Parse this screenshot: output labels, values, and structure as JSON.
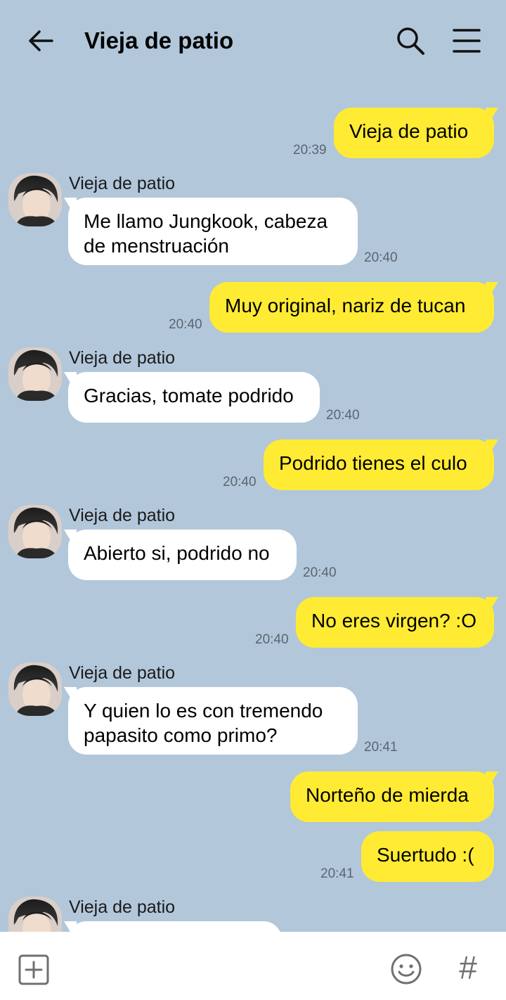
{
  "header": {
    "title": "Vieja de patio",
    "back_icon": "arrow-left-icon",
    "search_icon": "search-icon",
    "menu_icon": "hamburger-menu-icon"
  },
  "messages": [
    {
      "dir": "out",
      "text": "Vieja de patio",
      "time": "20:39"
    },
    {
      "dir": "in",
      "sender": "Vieja de patio",
      "lines": [
        "Me llamo Jungkook, cabeza",
        "de menstruación"
      ],
      "time": "20:40"
    },
    {
      "dir": "out",
      "text": "Muy original, nariz de tucan",
      "time": "20:40"
    },
    {
      "dir": "in",
      "sender": "Vieja de patio",
      "text": "Gracias, tomate podrido",
      "time": "20:40"
    },
    {
      "dir": "out",
      "text": "Podrido tienes el culo",
      "time": "20:40"
    },
    {
      "dir": "in",
      "sender": "Vieja de patio",
      "text": "Abierto si, podrido no",
      "time": "20:40"
    },
    {
      "dir": "out",
      "text": "No eres virgen? :O",
      "time": "20:40"
    },
    {
      "dir": "in",
      "sender": "Vieja de patio",
      "lines": [
        "Y quien lo es con tremendo",
        "papasito como primo?"
      ],
      "time": "20:41"
    },
    {
      "dir": "out",
      "text": "Norteño de mierda"
    },
    {
      "dir": "out",
      "text": "Suertudo :(",
      "time": "20:41"
    },
    {
      "dir": "in",
      "sender": "Vieja de patio"
    }
  ],
  "footer": {
    "plus_icon": "plus-box-icon",
    "emoji_icon": "smiley-icon",
    "hash_label": "#"
  },
  "colors": {
    "background": "#b2c7da",
    "outgoing_bubble": "#ffeb33",
    "incoming_bubble": "#ffffff"
  }
}
